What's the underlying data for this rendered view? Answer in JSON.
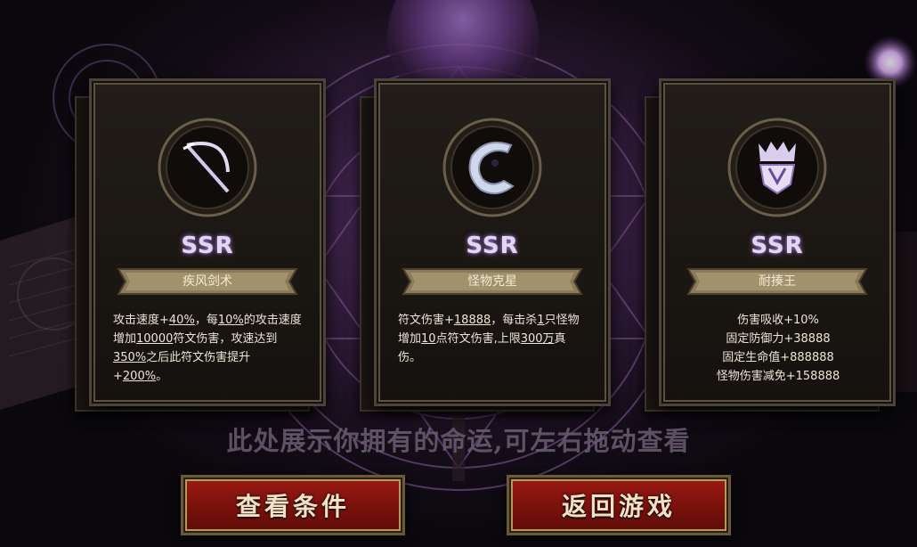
{
  "cards": [
    {
      "rarity": "SSR",
      "name": "疾风剑术",
      "icon": "scythe-icon",
      "desc_parts": [
        "攻击速度+",
        "40%",
        "，每",
        "10%",
        "的攻击速度增加",
        "10000",
        "符文伤害，攻速达到",
        "350%",
        "之后此符文伤害提升+",
        "200%",
        "。"
      ]
    },
    {
      "rarity": "SSR",
      "name": "怪物克星",
      "icon": "dragon-icon",
      "desc_parts": [
        "符文伤害+",
        "18888",
        "，每击杀",
        "1",
        "只怪物增加",
        "10",
        "点符文伤害,上限",
        "300万",
        "真伤。"
      ]
    },
    {
      "rarity": "SSR",
      "name": "耐揍王",
      "icon": "crown-shield-icon",
      "desc_lines": [
        "伤害吸收+10%",
        "固定防御力+38888",
        "固定生命值+888888",
        "怪物伤害减免+158888"
      ]
    }
  ],
  "hint": "此处展示你拥有的命运,可左右拖动查看",
  "buttons": {
    "view_conditions": "查看条件",
    "return_game": "返回游戏"
  },
  "colors": {
    "rarity_glow": "#a27bd6",
    "button_red": "#8a160f",
    "button_border_gold": "#b39a5c"
  }
}
